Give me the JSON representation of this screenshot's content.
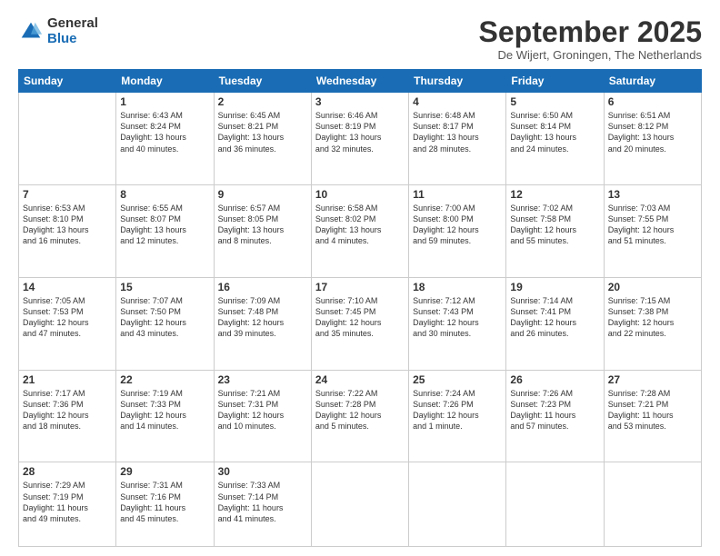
{
  "logo": {
    "general": "General",
    "blue": "Blue"
  },
  "header": {
    "month": "September 2025",
    "location": "De Wijert, Groningen, The Netherlands"
  },
  "days": [
    "Sunday",
    "Monday",
    "Tuesday",
    "Wednesday",
    "Thursday",
    "Friday",
    "Saturday"
  ],
  "weeks": [
    [
      {
        "day": "",
        "lines": []
      },
      {
        "day": "1",
        "lines": [
          "Sunrise: 6:43 AM",
          "Sunset: 8:24 PM",
          "Daylight: 13 hours",
          "and 40 minutes."
        ]
      },
      {
        "day": "2",
        "lines": [
          "Sunrise: 6:45 AM",
          "Sunset: 8:21 PM",
          "Daylight: 13 hours",
          "and 36 minutes."
        ]
      },
      {
        "day": "3",
        "lines": [
          "Sunrise: 6:46 AM",
          "Sunset: 8:19 PM",
          "Daylight: 13 hours",
          "and 32 minutes."
        ]
      },
      {
        "day": "4",
        "lines": [
          "Sunrise: 6:48 AM",
          "Sunset: 8:17 PM",
          "Daylight: 13 hours",
          "and 28 minutes."
        ]
      },
      {
        "day": "5",
        "lines": [
          "Sunrise: 6:50 AM",
          "Sunset: 8:14 PM",
          "Daylight: 13 hours",
          "and 24 minutes."
        ]
      },
      {
        "day": "6",
        "lines": [
          "Sunrise: 6:51 AM",
          "Sunset: 8:12 PM",
          "Daylight: 13 hours",
          "and 20 minutes."
        ]
      }
    ],
    [
      {
        "day": "7",
        "lines": [
          "Sunrise: 6:53 AM",
          "Sunset: 8:10 PM",
          "Daylight: 13 hours",
          "and 16 minutes."
        ]
      },
      {
        "day": "8",
        "lines": [
          "Sunrise: 6:55 AM",
          "Sunset: 8:07 PM",
          "Daylight: 13 hours",
          "and 12 minutes."
        ]
      },
      {
        "day": "9",
        "lines": [
          "Sunrise: 6:57 AM",
          "Sunset: 8:05 PM",
          "Daylight: 13 hours",
          "and 8 minutes."
        ]
      },
      {
        "day": "10",
        "lines": [
          "Sunrise: 6:58 AM",
          "Sunset: 8:02 PM",
          "Daylight: 13 hours",
          "and 4 minutes."
        ]
      },
      {
        "day": "11",
        "lines": [
          "Sunrise: 7:00 AM",
          "Sunset: 8:00 PM",
          "Daylight: 12 hours",
          "and 59 minutes."
        ]
      },
      {
        "day": "12",
        "lines": [
          "Sunrise: 7:02 AM",
          "Sunset: 7:58 PM",
          "Daylight: 12 hours",
          "and 55 minutes."
        ]
      },
      {
        "day": "13",
        "lines": [
          "Sunrise: 7:03 AM",
          "Sunset: 7:55 PM",
          "Daylight: 12 hours",
          "and 51 minutes."
        ]
      }
    ],
    [
      {
        "day": "14",
        "lines": [
          "Sunrise: 7:05 AM",
          "Sunset: 7:53 PM",
          "Daylight: 12 hours",
          "and 47 minutes."
        ]
      },
      {
        "day": "15",
        "lines": [
          "Sunrise: 7:07 AM",
          "Sunset: 7:50 PM",
          "Daylight: 12 hours",
          "and 43 minutes."
        ]
      },
      {
        "day": "16",
        "lines": [
          "Sunrise: 7:09 AM",
          "Sunset: 7:48 PM",
          "Daylight: 12 hours",
          "and 39 minutes."
        ]
      },
      {
        "day": "17",
        "lines": [
          "Sunrise: 7:10 AM",
          "Sunset: 7:45 PM",
          "Daylight: 12 hours",
          "and 35 minutes."
        ]
      },
      {
        "day": "18",
        "lines": [
          "Sunrise: 7:12 AM",
          "Sunset: 7:43 PM",
          "Daylight: 12 hours",
          "and 30 minutes."
        ]
      },
      {
        "day": "19",
        "lines": [
          "Sunrise: 7:14 AM",
          "Sunset: 7:41 PM",
          "Daylight: 12 hours",
          "and 26 minutes."
        ]
      },
      {
        "day": "20",
        "lines": [
          "Sunrise: 7:15 AM",
          "Sunset: 7:38 PM",
          "Daylight: 12 hours",
          "and 22 minutes."
        ]
      }
    ],
    [
      {
        "day": "21",
        "lines": [
          "Sunrise: 7:17 AM",
          "Sunset: 7:36 PM",
          "Daylight: 12 hours",
          "and 18 minutes."
        ]
      },
      {
        "day": "22",
        "lines": [
          "Sunrise: 7:19 AM",
          "Sunset: 7:33 PM",
          "Daylight: 12 hours",
          "and 14 minutes."
        ]
      },
      {
        "day": "23",
        "lines": [
          "Sunrise: 7:21 AM",
          "Sunset: 7:31 PM",
          "Daylight: 12 hours",
          "and 10 minutes."
        ]
      },
      {
        "day": "24",
        "lines": [
          "Sunrise: 7:22 AM",
          "Sunset: 7:28 PM",
          "Daylight: 12 hours",
          "and 5 minutes."
        ]
      },
      {
        "day": "25",
        "lines": [
          "Sunrise: 7:24 AM",
          "Sunset: 7:26 PM",
          "Daylight: 12 hours",
          "and 1 minute."
        ]
      },
      {
        "day": "26",
        "lines": [
          "Sunrise: 7:26 AM",
          "Sunset: 7:23 PM",
          "Daylight: 11 hours",
          "and 57 minutes."
        ]
      },
      {
        "day": "27",
        "lines": [
          "Sunrise: 7:28 AM",
          "Sunset: 7:21 PM",
          "Daylight: 11 hours",
          "and 53 minutes."
        ]
      }
    ],
    [
      {
        "day": "28",
        "lines": [
          "Sunrise: 7:29 AM",
          "Sunset: 7:19 PM",
          "Daylight: 11 hours",
          "and 49 minutes."
        ]
      },
      {
        "day": "29",
        "lines": [
          "Sunrise: 7:31 AM",
          "Sunset: 7:16 PM",
          "Daylight: 11 hours",
          "and 45 minutes."
        ]
      },
      {
        "day": "30",
        "lines": [
          "Sunrise: 7:33 AM",
          "Sunset: 7:14 PM",
          "Daylight: 11 hours",
          "and 41 minutes."
        ]
      },
      {
        "day": "",
        "lines": []
      },
      {
        "day": "",
        "lines": []
      },
      {
        "day": "",
        "lines": []
      },
      {
        "day": "",
        "lines": []
      }
    ]
  ]
}
